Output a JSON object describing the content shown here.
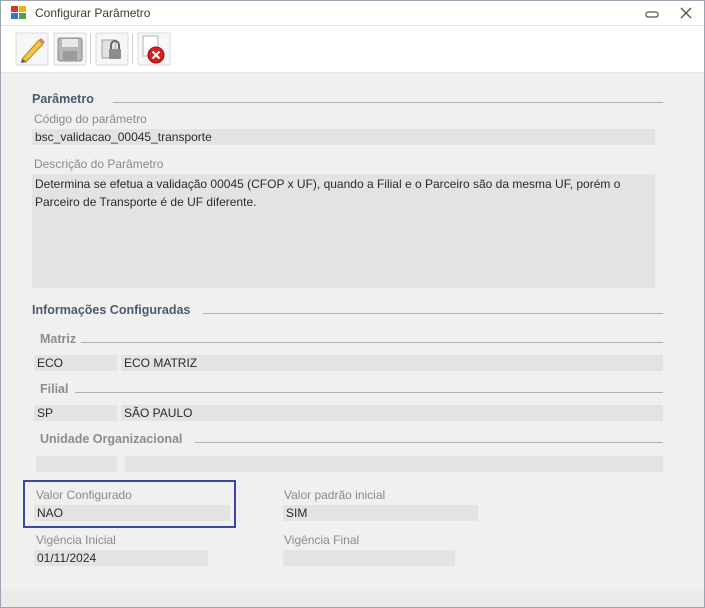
{
  "window": {
    "title": "Configurar Parâmetro"
  },
  "parametro": {
    "section_title": "Parâmetro",
    "codigo_label": "Código do parâmetro",
    "codigo_value": "bsc_validacao_00045_transporte",
    "descricao_label": "Descrição do Parâmetro",
    "descricao_value": "Determina se efetua a validação 00045 (CFOP x UF), quando a Filial e o Parceiro são da mesma UF, porém o Parceiro de Transporte é de UF diferente."
  },
  "info": {
    "section_title": "Informações Configuradas",
    "matriz_title": "Matriz",
    "matriz_code": "ECO",
    "matriz_name": "ECO MATRIZ",
    "filial_title": "Filial",
    "filial_code": "SP",
    "filial_name": "SÃO PAULO",
    "unidade_title": "Unidade Organizacional",
    "unidade_code": "",
    "unidade_name": ""
  },
  "valores": {
    "valor_configurado_label": "Valor Configurado",
    "valor_configurado_value": "NAO",
    "valor_padrao_label": "Valor padrão inicial",
    "valor_padrao_value": "SIM",
    "vigencia_inicial_label": "Vigência Inicial",
    "vigencia_inicial_value": "01/11/2024",
    "vigencia_final_label": "Vigência Final",
    "vigencia_final_value": ""
  },
  "toolbar": {
    "icons": [
      "edit-pencil-icon",
      "save-disk-icon",
      "lock-icon",
      "cancel-icon"
    ]
  },
  "colors": {
    "highlight_border": "#3c48a0",
    "section_title": "#4a5a70",
    "cancel_red": "#d62020"
  }
}
